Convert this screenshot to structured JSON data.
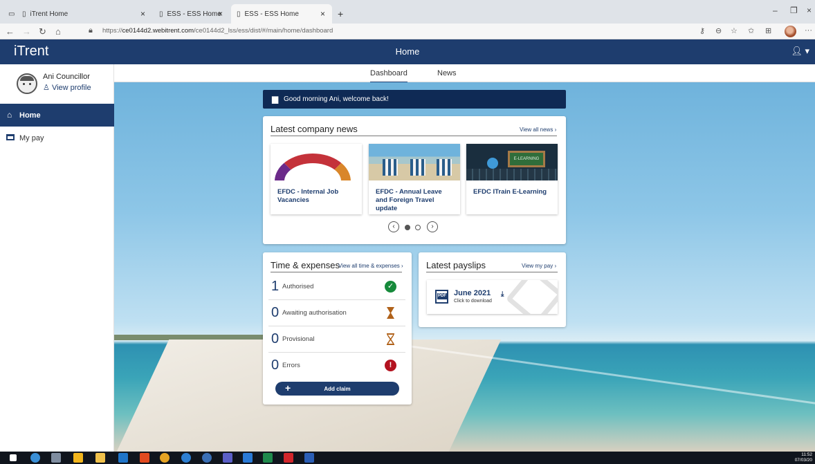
{
  "browser": {
    "tabs": [
      {
        "title": "iTrent Home"
      },
      {
        "title": "ESS - ESS Home"
      },
      {
        "title": "ESS - ESS Home"
      }
    ],
    "new_tab": "+",
    "url_prefix": "https://",
    "url_host": "ce0144d2.webitrent.com",
    "url_path": "/ce0144d2_lss/ess/dist/#/main/home/dashboard"
  },
  "app": {
    "brand": "iTrent",
    "header_title": "Home"
  },
  "sidebar": {
    "user_name": "Ani Councillor",
    "view_profile": "View profile",
    "items": [
      {
        "label": "Home"
      },
      {
        "label": "My pay"
      }
    ]
  },
  "subnav": {
    "tabs": [
      {
        "label": "Dashboard"
      },
      {
        "label": "News"
      }
    ]
  },
  "welcome": {
    "message": "Good morning Ani, welcome back!"
  },
  "news": {
    "title": "Latest company news",
    "view_all": "View all news",
    "items": [
      {
        "title": "EFDC - Internal Job Vacancies"
      },
      {
        "title": "EFDC - Annual Leave and Foreign Travel update"
      },
      {
        "title": "EFDC ITrain E-Learning"
      }
    ],
    "image_text": "E-LEARNING"
  },
  "time_expenses": {
    "title": "Time & expenses",
    "view_all": "View all time & expenses",
    "rows": [
      {
        "count": "1",
        "label": "Authorised"
      },
      {
        "count": "0",
        "label": "Awaiting authorisation"
      },
      {
        "count": "0",
        "label": "Provisional"
      },
      {
        "count": "0",
        "label": "Errors"
      }
    ],
    "add_claim": "Add claim"
  },
  "payslips": {
    "title": "Latest payslips",
    "view_all": "View my pay",
    "pdf_label": "PDF",
    "month": "June 2021",
    "hint": "Click to download"
  },
  "taskbar": {
    "time": "11:52",
    "date": "07/03/20"
  }
}
